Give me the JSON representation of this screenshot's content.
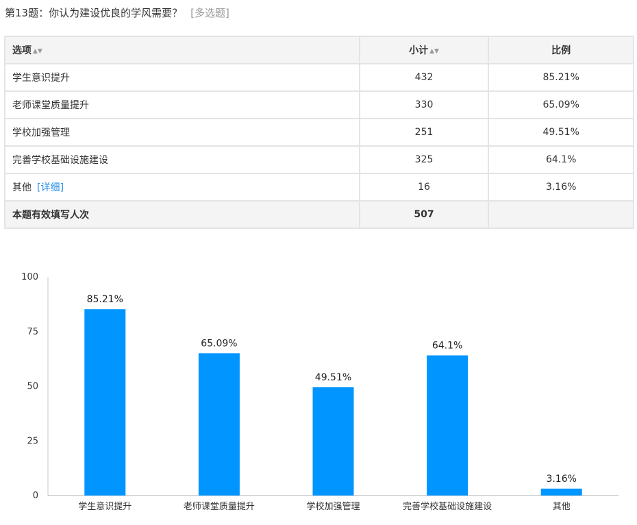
{
  "question": {
    "title": "第13题：你认为建设优良的学风需要？",
    "type_tag": "[多选题]"
  },
  "table": {
    "headers": {
      "option": "选项",
      "count": "小计",
      "ratio": "比例"
    },
    "sort_icon": "sort-icon",
    "rows": [
      {
        "option": "学生意识提升",
        "count": "432",
        "ratio": "85.21%"
      },
      {
        "option": "老师课堂质量提升",
        "count": "330",
        "ratio": "65.09%"
      },
      {
        "option": "学校加强管理",
        "count": "251",
        "ratio": "49.51%"
      },
      {
        "option": "完善学校基础设施建设",
        "count": "325",
        "ratio": "64.1%"
      },
      {
        "option": "其他",
        "count": "16",
        "ratio": "3.16%",
        "detail_link": "[详细]"
      }
    ],
    "total": {
      "label": "本题有效填写人次",
      "count": "507",
      "ratio": ""
    }
  },
  "colors": {
    "bar": "#0095ff",
    "link": "#1f8ceb",
    "header_bg": "#f4f4f4",
    "border": "#e4e4e4"
  },
  "chart_data": {
    "type": "bar",
    "categories": [
      "学生意识提升",
      "老师课堂质量提升",
      "学校加强管理",
      "完善学校基础设施建设",
      "其他"
    ],
    "values": [
      85.21,
      65.09,
      49.51,
      64.1,
      3.16
    ],
    "data_labels": [
      "85.21%",
      "65.09%",
      "49.51%",
      "64.1%",
      "3.16%"
    ],
    "ylim": [
      0,
      100
    ],
    "yticks": [
      0,
      25,
      50,
      75,
      100
    ],
    "title": "",
    "xlabel": "",
    "ylabel": "",
    "grid": false,
    "bar_color": "#0095ff"
  }
}
